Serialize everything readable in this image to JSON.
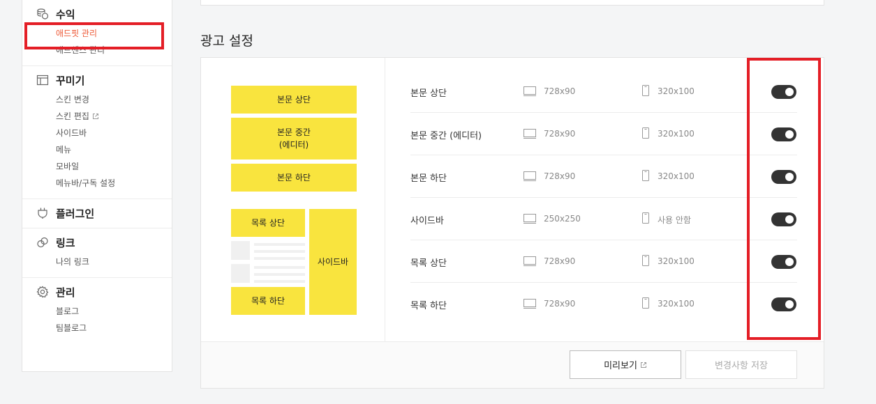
{
  "sidebar": {
    "sections": [
      {
        "title": "수익",
        "icon": "coins-icon",
        "items": [
          "애드핏 관리",
          "애드센스 관리"
        ],
        "active_index": 0
      },
      {
        "title": "꾸미기",
        "icon": "layout-icon",
        "items": [
          "스킨 변경",
          "스킨 편집",
          "사이드바",
          "메뉴",
          "모바일",
          "메뉴바/구독 설정"
        ],
        "external_index": 1
      },
      {
        "title": "플러그인",
        "icon": "plug-icon",
        "items": []
      },
      {
        "title": "링크",
        "icon": "link-icon",
        "items": [
          "나의 링크"
        ]
      },
      {
        "title": "관리",
        "icon": "gear-icon",
        "items": [
          "블로그",
          "팀블로그"
        ]
      }
    ]
  },
  "section_title": "광고 설정",
  "preview": {
    "top": "본문 상단",
    "middle_line1": "본문 중간",
    "middle_line2": "(에디터)",
    "bottom": "본문 하단",
    "list_top": "목록 상단",
    "list_bottom": "목록 하단",
    "sidebar": "사이드바"
  },
  "slots": [
    {
      "name": "본문 상단",
      "pc_size": "728x90",
      "mobile_size": "320x100",
      "enabled": true
    },
    {
      "name": "본문 중간 (에디터)",
      "pc_size": "728x90",
      "mobile_size": "320x100",
      "enabled": true
    },
    {
      "name": "본문 하단",
      "pc_size": "728x90",
      "mobile_size": "320x100",
      "enabled": true
    },
    {
      "name": "사이드바",
      "pc_size": "250x250",
      "mobile_size": "사용 안함",
      "enabled": true
    },
    {
      "name": "목록 상단",
      "pc_size": "728x90",
      "mobile_size": "320x100",
      "enabled": true
    },
    {
      "name": "목록 하단",
      "pc_size": "728x90",
      "mobile_size": "320x100",
      "enabled": true
    }
  ],
  "footer": {
    "preview_label": "미리보기",
    "save_label": "변경사항 저장"
  },
  "colors": {
    "accent_orange": "#ee5a37",
    "ad_yellow": "#f9e43e",
    "toggle_on": "#333333",
    "highlight_red": "#e41e26"
  }
}
